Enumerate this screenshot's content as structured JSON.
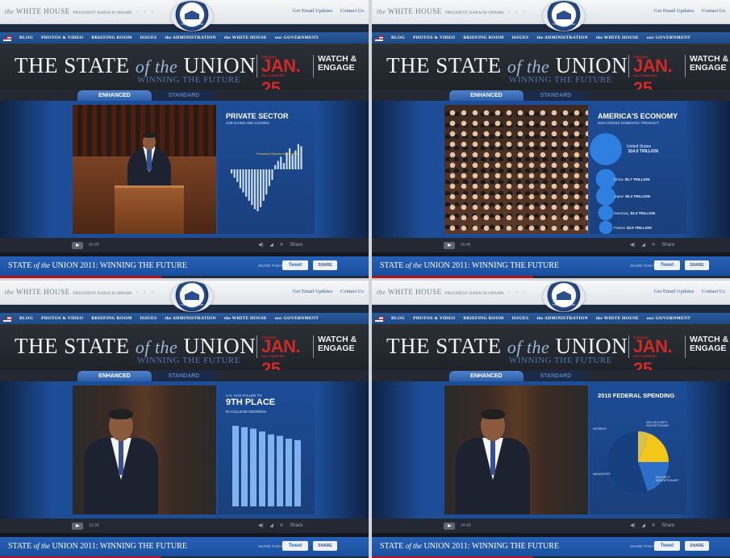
{
  "site": {
    "name_part1": "the",
    "name_part2": "WHITE HOUSE",
    "president": "PRESIDENT BARACK OBAMA",
    "seal_caption": "THE WHITE HOUSE",
    "links": [
      "Get Email Updates",
      "Contact Us"
    ],
    "nav": [
      "BLOG",
      "PHOTOS & VIDEO",
      "BRIEFING ROOM",
      "ISSUES",
      "the ADMINISTRATION",
      "the WHITE HOUSE",
      "our GOVERNMENT"
    ]
  },
  "header": {
    "title_a": "THE STATE ",
    "title_of": "of the",
    "title_b": " UNION",
    "subtitle": "WINNING THE FUTURE",
    "date_day": "TUESDAY",
    "date": "JAN. 25",
    "date_time": "2011, 9:00PM EST",
    "watch": "WATCH &",
    "engage": "ENGAGE"
  },
  "tabs": {
    "enhanced": "ENHANCED",
    "standard": "STANDARD"
  },
  "controls": {
    "share": "Share"
  },
  "footer": {
    "title_a": "STATE ",
    "title_of": "of the",
    "title_b": "UNION 2011: WINNING THE FUTURE",
    "share_label": "SHARE THIS PAGE",
    "tweet": "Tweet",
    "fb": "SHARE"
  },
  "panels": [
    {
      "time": "00:28",
      "info_title": "PRIVATE SECTOR",
      "info_sub": "JOB GAINS AND LOSSES",
      "chart_note": "President Obama takes office",
      "colors": {
        "bars": "#c9ddf5"
      }
    },
    {
      "time": "00:45",
      "info_title": "AMERICA'S ECONOMY",
      "info_sub": "2010 GROSS DOMESTIC PRODUCT",
      "economies": [
        {
          "label": "United States",
          "value": "$14.6 TRILLION"
        },
        {
          "label": "China",
          "value": "$5.7 TRILLION"
        },
        {
          "label": "Japan",
          "value": "$5.3 TRILLION"
        },
        {
          "label": "Germany",
          "value": "$3.3 TRILLION"
        },
        {
          "label": "France",
          "value": "$2.5 TRILLION"
        }
      ]
    },
    {
      "time": "13:39",
      "info_title_pre": "U.S. HAS FALLEN TO",
      "info_title": "9TH PLACE",
      "info_sub": "IN COLLEGE DEGREES"
    },
    {
      "time": "34:40",
      "info_title": "2010 FEDERAL SPENDING",
      "pie_labels": [
        "INTEREST",
        "NON-SECURITY DISCRETIONARY",
        "MANDATORY",
        "SECURITY DISCRETIONARY"
      ]
    }
  ],
  "chart_data": [
    {
      "type": "bar",
      "title": "PRIVATE SECTOR",
      "subtitle": "JOB GAINS AND LOSSES",
      "values": [
        -2,
        -4,
        -6,
        -9,
        -11,
        -13,
        -15,
        -17,
        -19,
        -20,
        -18,
        -15,
        -12,
        -8,
        -5,
        2,
        4,
        6,
        3,
        8,
        10,
        7,
        9,
        12,
        11
      ]
    },
    {
      "type": "scatter",
      "title": "AMERICA'S ECONOMY",
      "subtitle": "2010 GROSS DOMESTIC PRODUCT",
      "categories": [
        "United States",
        "China",
        "Japan",
        "Germany",
        "France"
      ],
      "values": [
        14.6,
        5.7,
        5.3,
        3.3,
        2.5
      ]
    },
    {
      "type": "bar",
      "title": "9TH PLACE",
      "subtitle": "IN COLLEGE DEGREES",
      "values": [
        56,
        55,
        54,
        52,
        50,
        49,
        47,
        46
      ]
    },
    {
      "type": "pie",
      "title": "2010 FEDERAL SPENDING",
      "categories": [
        "INTEREST",
        "NON-SECURITY DISCRETIONARY",
        "SECURITY DISCRETIONARY",
        "MANDATORY"
      ],
      "values": [
        6,
        19,
        20,
        55
      ]
    }
  ]
}
